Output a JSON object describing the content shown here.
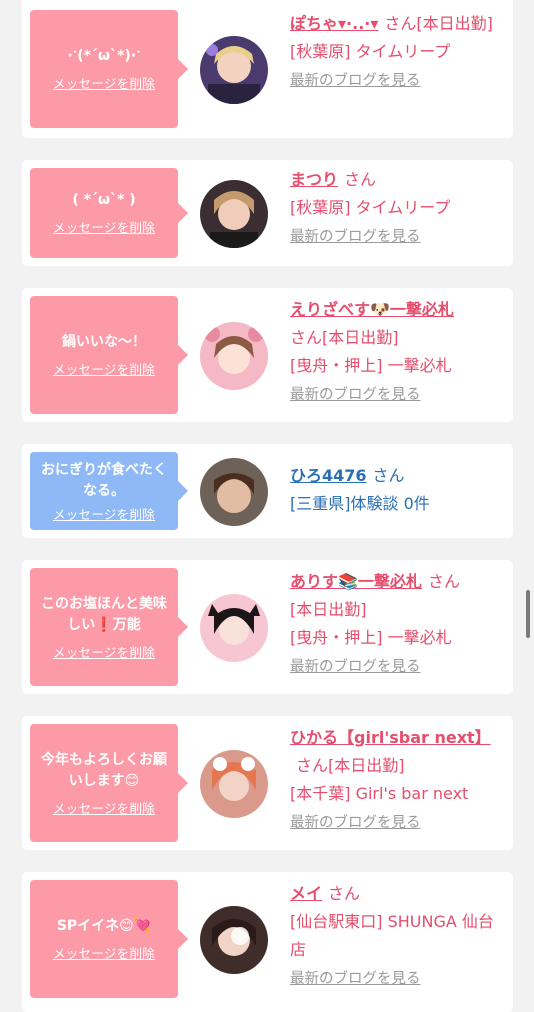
{
  "cards": [
    {
      "message": "·ॱ(*´ω`*)·ॱ",
      "delete_label": "メッセージを削除",
      "bubble_color": "#fd9aa7",
      "name": "ぽちゃ▾·..·▾",
      "san": "さん",
      "line1": "[本日出勤]",
      "line2": "[秋葉原] タイムリープ",
      "blog": "最新のブログを見る"
    },
    {
      "message": "( *´ω`* )",
      "delete_label": "メッセージを削除",
      "bubble_color": "#fd9aa7",
      "name": "まつり",
      "san": "さん",
      "line1": "",
      "line2": "[秋葉原] タイムリープ",
      "blog": "最新のブログを見る"
    },
    {
      "message": "鍋いいな〜！",
      "delete_label": "メッセージを削除",
      "bubble_color": "#fd9aa7",
      "name": "えりざべす🐶一撃必札",
      "san": "さん",
      "line1": "[本日出勤]",
      "line2": "[曳舟・押上] 一撃必札",
      "blog": "最新のブログを見る"
    },
    {
      "message": "おにぎりが食べたくなる。",
      "delete_label": "メッセージを削除",
      "bubble_color": "#8fb8f7",
      "name": "ひろ4476",
      "san": "さん",
      "line1": "",
      "line2": "[三重県]体験談 0件",
      "blog": ""
    },
    {
      "message": "このお塩ほんと美味しい❗️万能",
      "delete_label": "メッセージを削除",
      "bubble_color": "#fd9aa7",
      "name": "ありす📚一撃必札",
      "san": "さん",
      "line1": "[本日出勤]",
      "line2": "[曳舟・押上] 一撃必札",
      "blog": "最新のブログを見る"
    },
    {
      "message": "今年もよろしくお願いします😊",
      "delete_label": "メッセージを削除",
      "bubble_color": "#fd9aa7",
      "name": "ひかる【girl'sbar next】",
      "san": "さん",
      "line1": "[本日出勤]",
      "line2": "[本千葉] Girl's bar next",
      "blog": "最新のブログを見る"
    },
    {
      "message": "SPイイネ😊💘",
      "delete_label": "メッセージを削除",
      "bubble_color": "#fd9aa7",
      "name": "メイ",
      "san": "さん",
      "line1": "",
      "line2": "[仙台駅東口] SHUNGA 仙台店",
      "blog": "最新のブログを見る"
    }
  ]
}
